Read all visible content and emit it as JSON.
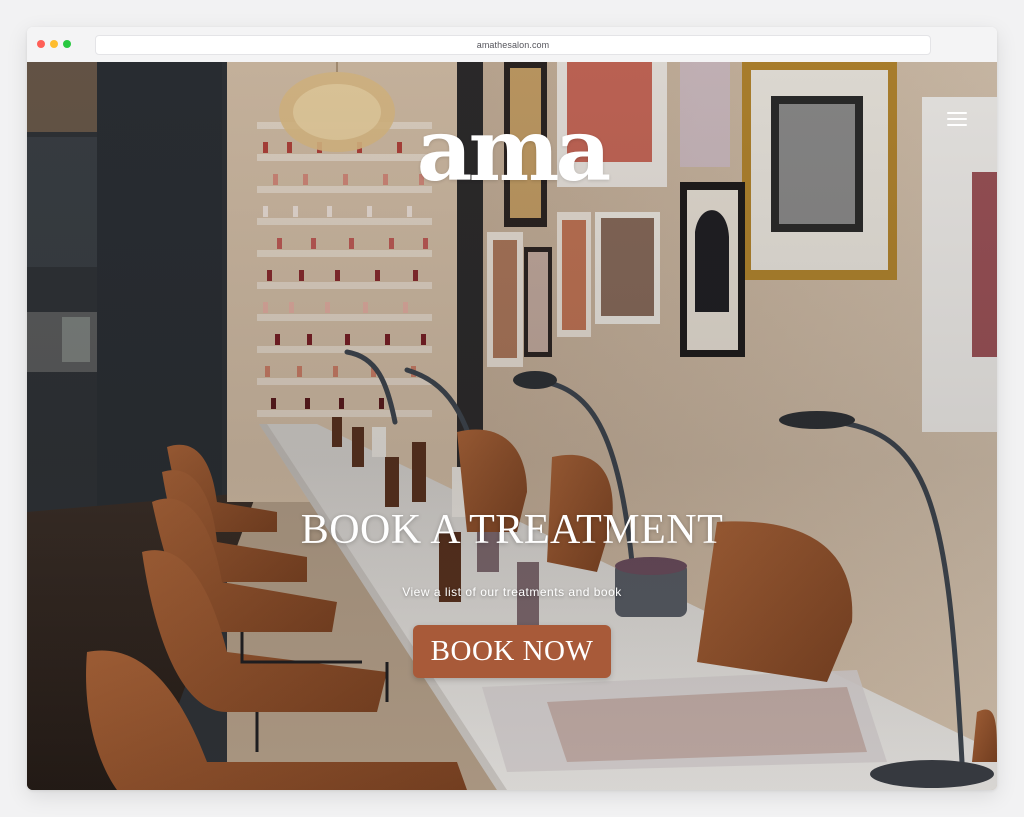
{
  "browser": {
    "url": "amathesalon.com"
  },
  "header": {
    "logo_text": "ama",
    "menu_icon": "hamburger-menu-icon"
  },
  "hero": {
    "title": "BOOK A TREATMENT",
    "subtitle": "View a list of our treatments and book",
    "cta_label": "BOOK NOW",
    "image": "nail-salon-interior-photo"
  },
  "colors": {
    "cta_background": "#a85a39",
    "text": "#ffffff"
  }
}
